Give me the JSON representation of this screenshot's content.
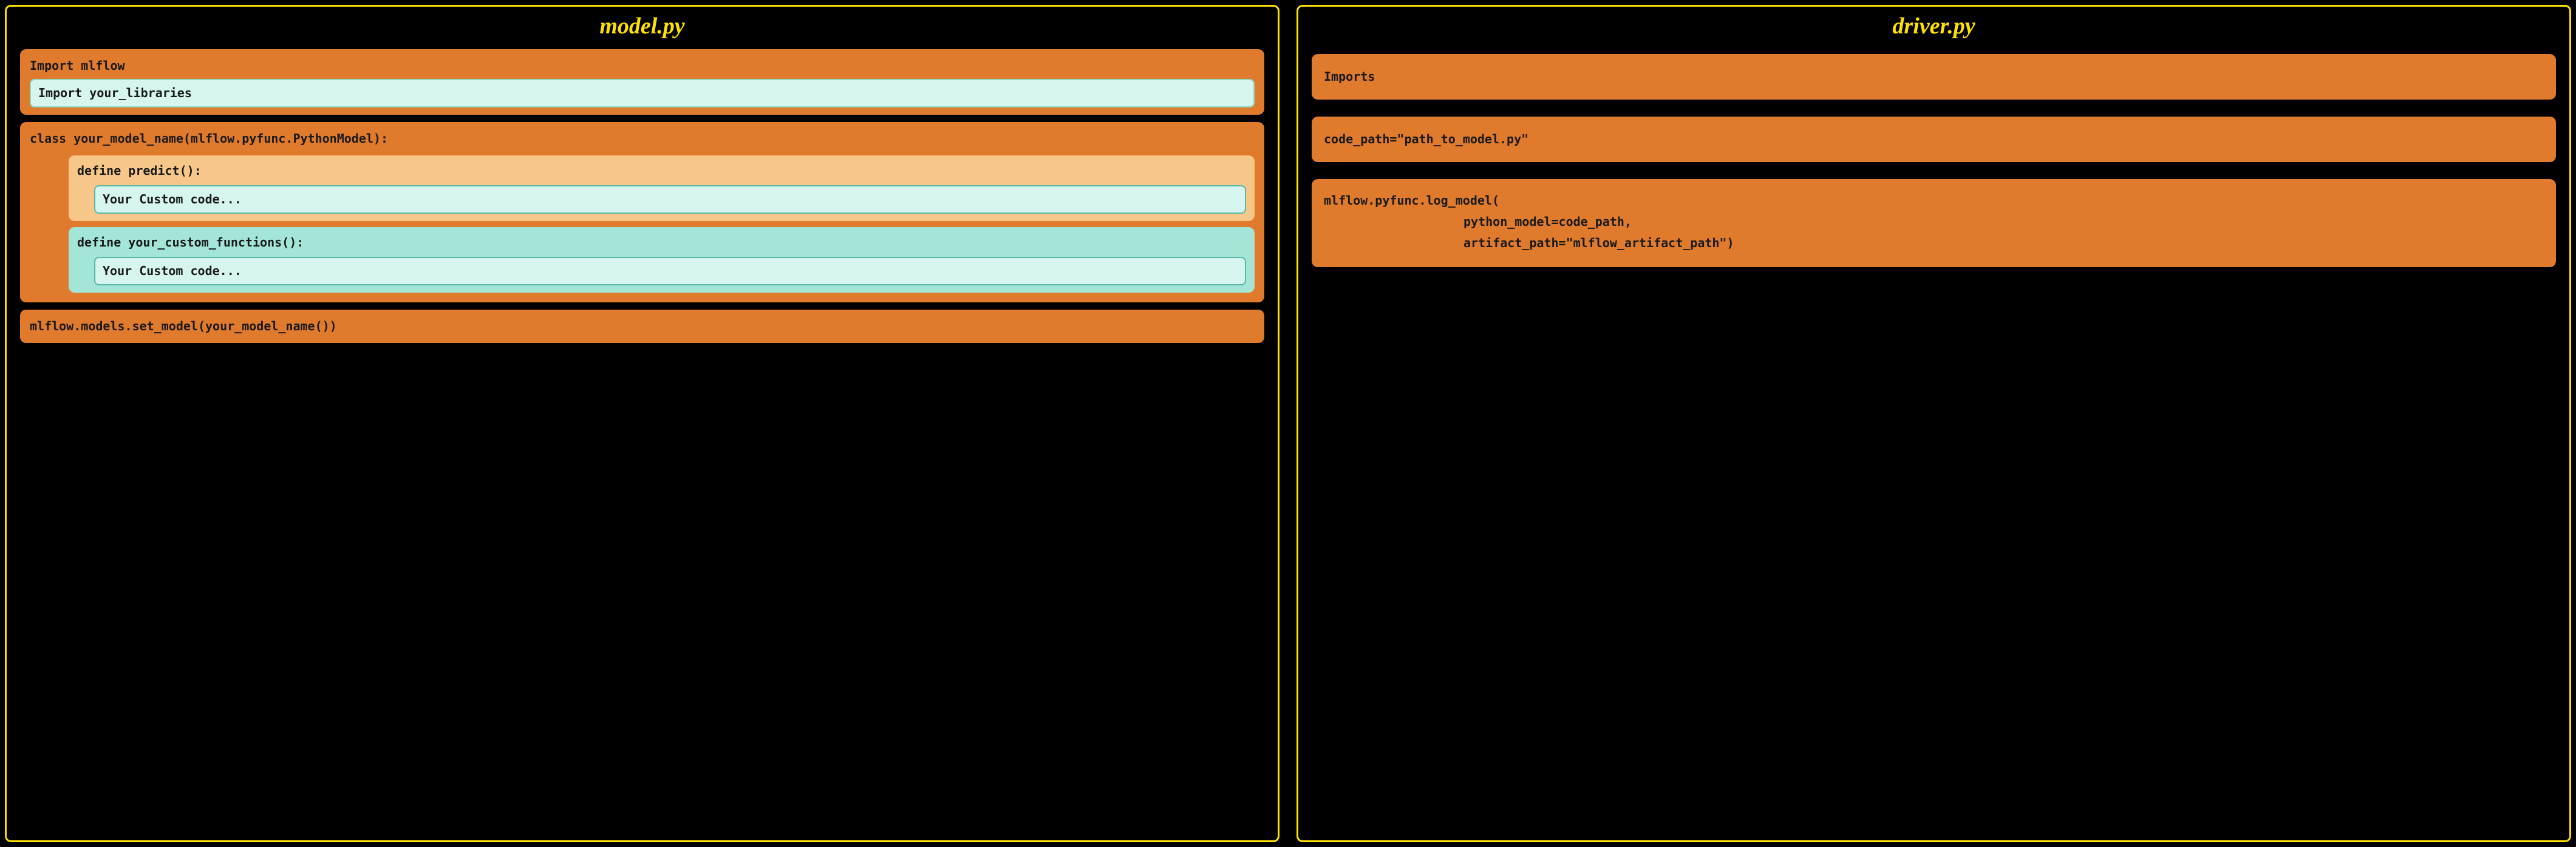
{
  "left": {
    "title": "model.py",
    "imports": {
      "line1": "Import mlflow",
      "line2": "Import your_libraries"
    },
    "classdef": {
      "decl": "class your_model_name(mlflow.pyfunc.PythonModel):",
      "predict": {
        "decl": "define predict():",
        "body": "Your Custom code..."
      },
      "custom": {
        "decl": "define your_custom_functions():",
        "body": "Your Custom code..."
      }
    },
    "setmodel": "mlflow.models.set_model(your_model_name())"
  },
  "right": {
    "title": "driver.py",
    "imports": "Imports",
    "codepath": "code_path=\"path_to_model.py\"",
    "logmodel": {
      "call": "mlflow.pyfunc.log_model(",
      "arg1": "python_model=code_path,",
      "arg2": "artifact_path=\"mlflow_artifact_path\")"
    }
  }
}
